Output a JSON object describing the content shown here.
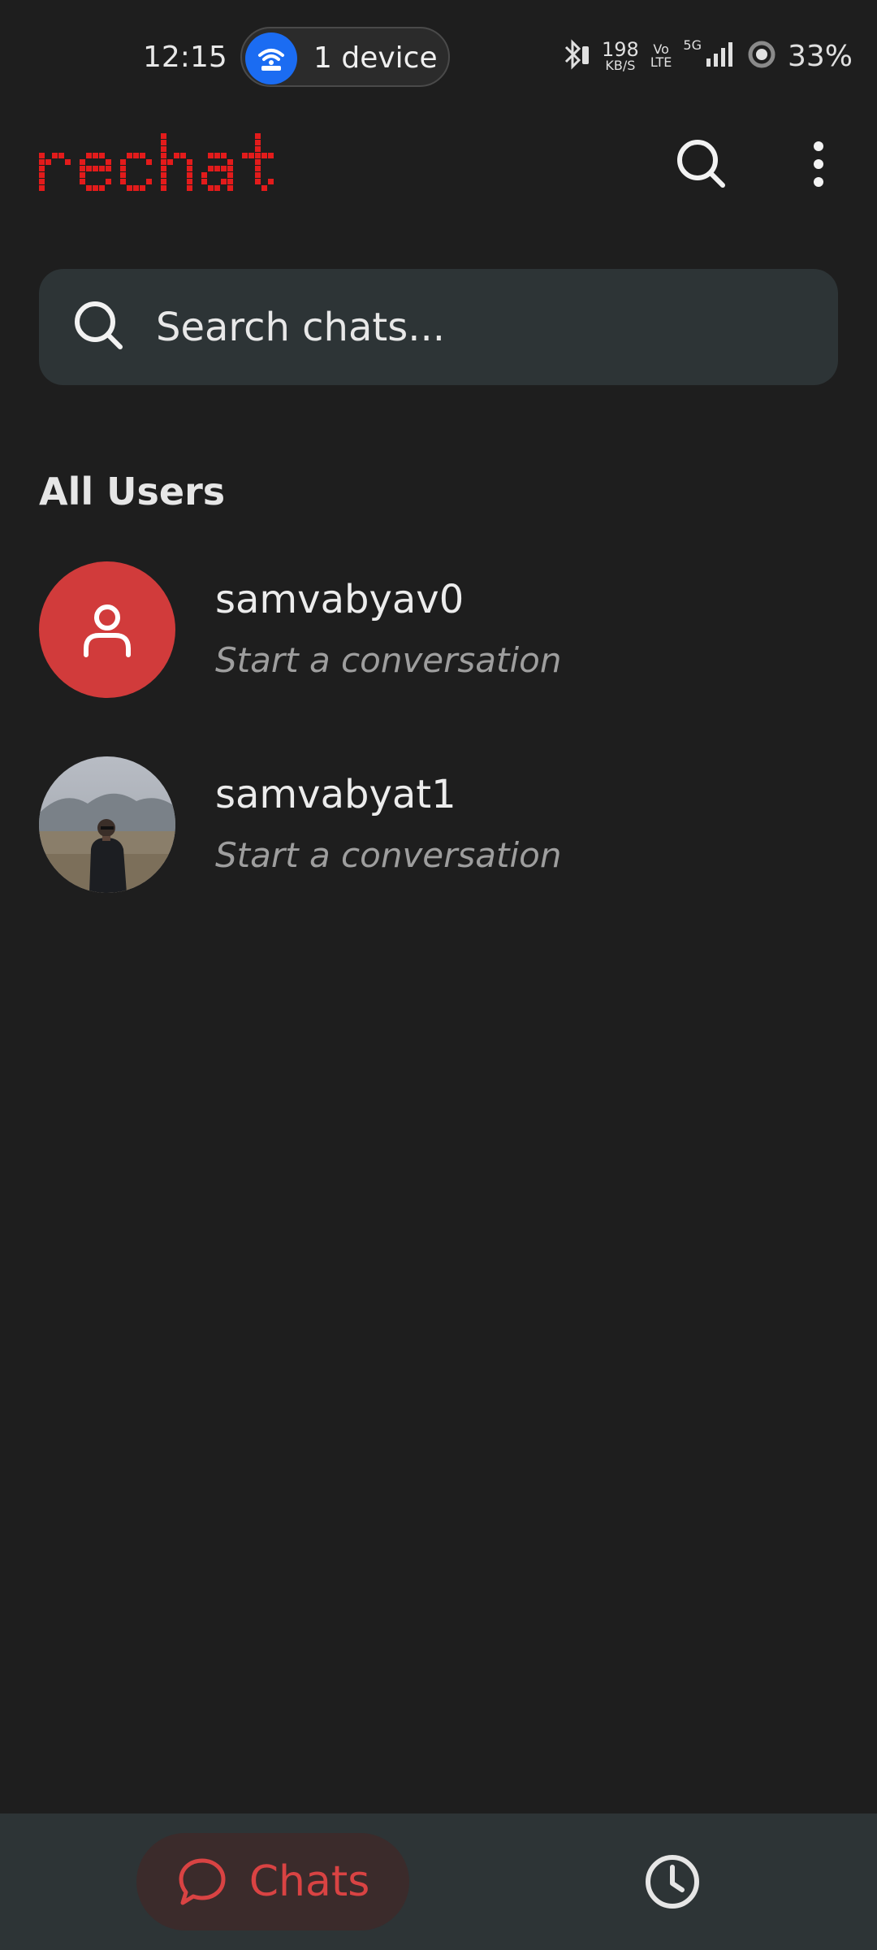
{
  "status_bar": {
    "time": "12:15",
    "pill_text": "1 device",
    "speed_value": "198",
    "speed_unit": "KB/S",
    "volte_top": "Vo",
    "volte_bottom": "LTE",
    "network": "5G",
    "battery": "33%"
  },
  "app": {
    "logo_text": "rechat",
    "brand_color": "#e31b1b"
  },
  "search": {
    "placeholder": "Search chats..."
  },
  "section": {
    "title": "All Users"
  },
  "users": [
    {
      "name": "samvabyav0",
      "subtitle": "Start a conversation",
      "avatar": "default-person-icon"
    },
    {
      "name": "samvabyat1",
      "subtitle": "Start a conversation",
      "avatar": "photo"
    }
  ],
  "bottom_nav": {
    "chats_label": "Chats",
    "accent": "#d94343"
  }
}
